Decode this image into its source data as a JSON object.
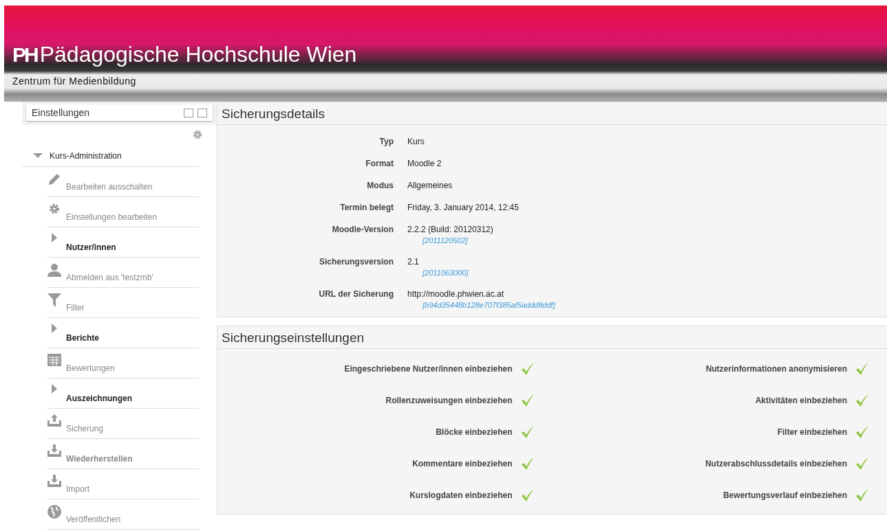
{
  "banner": {
    "title": "Pädagogische Hochschule Wien",
    "logo": "PH",
    "subtitle": "Zentrum für Medienbildung"
  },
  "sidebar": {
    "block_title": "Einstellungen",
    "section": {
      "label": "Kurs-Administration",
      "expanded": true
    },
    "items": [
      {
        "kind": "pencil",
        "label": "Bearbeiten ausschalten",
        "bold": false
      },
      {
        "kind": "gear",
        "label": "Einstellungen bearbeiten",
        "bold": false
      },
      {
        "kind": "branch",
        "label": "Nutzer/innen",
        "bold": true
      },
      {
        "kind": "user",
        "label": "Abmelden aus 'testzmb'",
        "bold": false
      },
      {
        "kind": "filter",
        "label": "Filter",
        "bold": false
      },
      {
        "kind": "branch",
        "label": "Berichte",
        "bold": true
      },
      {
        "kind": "table",
        "label": "Bewertungen",
        "bold": false
      },
      {
        "kind": "branch",
        "label": "Auszeichnungen",
        "bold": true
      },
      {
        "kind": "upload",
        "label": "Sicherung",
        "bold": false
      },
      {
        "kind": "download",
        "label": "Wiederherstellen",
        "bold": true
      },
      {
        "kind": "download",
        "label": "Import",
        "bold": false
      },
      {
        "kind": "globe",
        "label": "Veröffentlichen",
        "bold": false
      }
    ]
  },
  "details": {
    "title": "Sicherungsdetails",
    "rows": [
      {
        "label": "Typ",
        "value": "Kurs"
      },
      {
        "label": "Format",
        "value": "Moodle 2"
      },
      {
        "label": "Modus",
        "value": "Allgemeines"
      },
      {
        "label": "Termin belegt",
        "value": "Friday, 3. January 2014, 12:45"
      },
      {
        "label": "Moodle-Version",
        "value": "2.2.2 (Build: 20120312)",
        "note": "[2011120502]"
      },
      {
        "label": "Sicherungsversion",
        "value": "2.1",
        "note": "[2011063000]"
      },
      {
        "label": "URL der Sicherung",
        "value": "http://moodle.phwien.ac.at",
        "note": "[b94d35448b128e707f385af5addd8ddf]"
      }
    ]
  },
  "settings": {
    "title": "Sicherungseinstellungen",
    "items": [
      {
        "label": "Eingeschriebene Nutzer/innen einbeziehen",
        "checked": true
      },
      {
        "label": "Nutzerinformationen anonymisieren",
        "checked": true
      },
      {
        "label": "Rollenzuweisungen einbeziehen",
        "checked": true
      },
      {
        "label": "Aktivitäten einbeziehen",
        "checked": true
      },
      {
        "label": "Blöcke einbeziehen",
        "checked": true
      },
      {
        "label": "Filter einbeziehen",
        "checked": true
      },
      {
        "label": "Kommentare einbeziehen",
        "checked": true
      },
      {
        "label": "Nutzerabschlussdetails einbeziehen",
        "checked": true
      },
      {
        "label": "Kurslogdaten einbeziehen",
        "checked": true
      },
      {
        "label": "Bewertungsverlauf einbeziehen",
        "checked": true
      }
    ]
  }
}
